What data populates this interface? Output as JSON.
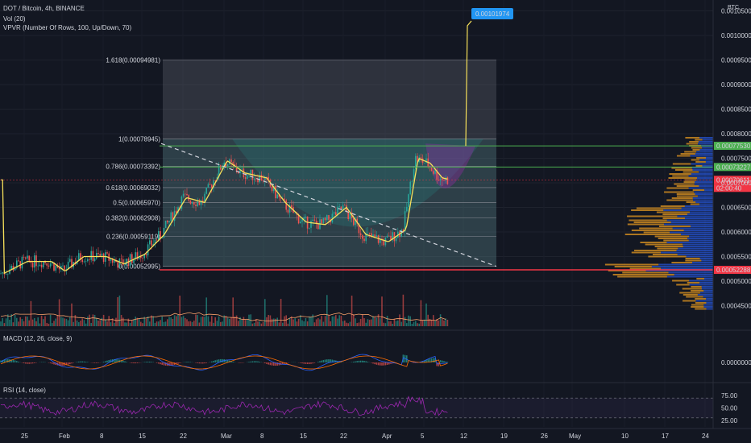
{
  "header": {
    "symbol": "DOT / Bitcoin, 4h, BINANCE",
    "vol": "Vol (20)",
    "vpvr": "VPVR (Number Of Rows, 100, Up/Down, 70)",
    "macd": "MACD (12, 26, close, 9)",
    "rsi": "RSI (14, close)"
  },
  "axis": {
    "currency": "BTC"
  },
  "colors": {
    "bg": "#131722",
    "up": "#26a69a",
    "down": "#ef5350",
    "ma": "#f7e15a",
    "fib_box": "#5d606b",
    "green_line": "#4caf50",
    "red_line": "#f23645",
    "badge_blue": "#2196f3",
    "rsi": "#9c27b0",
    "vol_up": "#2962ff",
    "vol_down": "#f0a020"
  },
  "chart_data": {
    "type": "candlestick",
    "price_axis": {
      "ticks": [
        "0.00105000",
        "0.00100000",
        "0.00095000",
        "0.00090000",
        "0.00085000",
        "0.00080000",
        "0.00075000",
        "0.00070000",
        "0.00065000",
        "0.00060000",
        "0.00055000",
        "0.00050000",
        "0.00045000"
      ],
      "ylim": [
        0.00042,
        0.00106
      ]
    },
    "time_axis": {
      "ticks": [
        "25",
        "Feb",
        "8",
        "15",
        "22",
        "Mar",
        "8",
        "15",
        "22",
        "Apr",
        "5",
        "12",
        "19",
        "26",
        "May",
        "10",
        "17",
        "24"
      ]
    },
    "fib_levels": [
      {
        "ratio": "1.618",
        "value": "0.00094981"
      },
      {
        "ratio": "1",
        "value": "0.00078945"
      },
      {
        "ratio": "0.786",
        "value": "0.00073392"
      },
      {
        "ratio": "0.618",
        "value": "0.00069032"
      },
      {
        "ratio": "0.5",
        "value": "0.00065970"
      },
      {
        "ratio": "0.382",
        "value": "0.00062908"
      },
      {
        "ratio": "0.236",
        "value": "0.00059119"
      },
      {
        "ratio": "0",
        "value": "0.00052995"
      }
    ],
    "price_labels": [
      {
        "value": "0.00077530",
        "role": "green-resistance"
      },
      {
        "value": "0.00073227",
        "role": "green-support"
      },
      {
        "value": "0.00070611",
        "role": "current-price"
      },
      {
        "value": "02:00:40",
        "role": "countdown"
      },
      {
        "value": "0.00052288",
        "role": "red-support"
      }
    ],
    "target_badge": "0.00101974",
    "close_path": [
      [
        "25",
        0.00052
      ],
      [
        "Feb",
        0.00054
      ],
      [
        "8",
        0.000545
      ],
      [
        "15",
        0.00056
      ],
      [
        "22",
        0.00068
      ],
      [
        "Mar",
        0.00071
      ],
      [
        "8",
        0.00069
      ],
      [
        "15",
        0.00063
      ],
      [
        "22",
        0.00064
      ],
      [
        "Apr",
        0.00059
      ],
      [
        "5",
        0.00076
      ],
      [
        "12",
        0.000706
      ]
    ],
    "macd_axis": "0.00000000",
    "rsi_axis": [
      "75.00",
      "50.00",
      "25.00"
    ]
  }
}
